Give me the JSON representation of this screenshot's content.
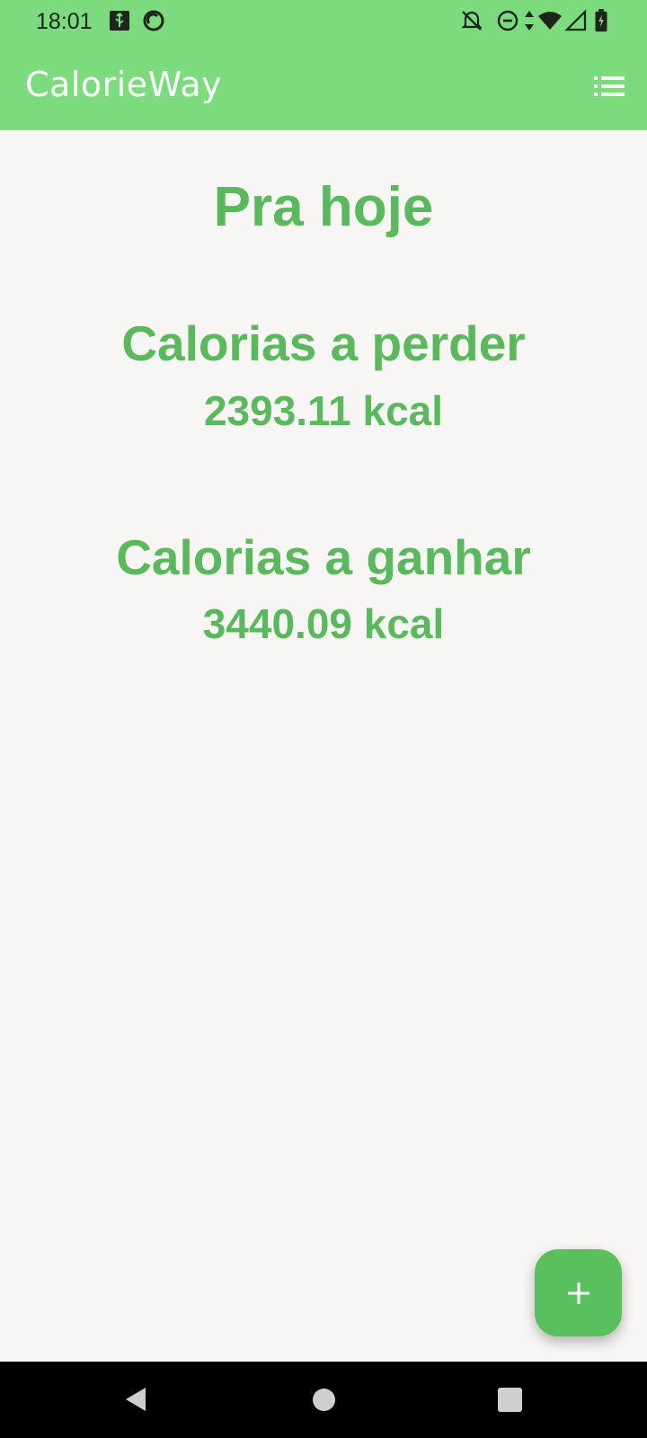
{
  "status_bar": {
    "time": "18:01",
    "left_icons": [
      "usb-icon",
      "sync-icon"
    ],
    "right_icons": [
      "notifications-off-icon",
      "do-not-disturb-icon",
      "data-arrows-icon",
      "wifi-icon",
      "signal-icon",
      "battery-charging-icon"
    ]
  },
  "app_bar": {
    "title": "CalorieWay",
    "menu_icon": "list-icon",
    "background": "#7bdb7d"
  },
  "main": {
    "heading": "Pra hoje",
    "lose": {
      "label": "Calorias a perder",
      "value": "2393.11 kcal"
    },
    "gain": {
      "label": "Calorias a ganhar",
      "value": "3440.09 kcal"
    },
    "text_color": "#5ab95c"
  },
  "fab": {
    "icon": "plus-icon",
    "color": "#5abf5d"
  },
  "nav_bar": {
    "buttons": [
      "back-icon",
      "home-icon",
      "recents-icon"
    ]
  }
}
